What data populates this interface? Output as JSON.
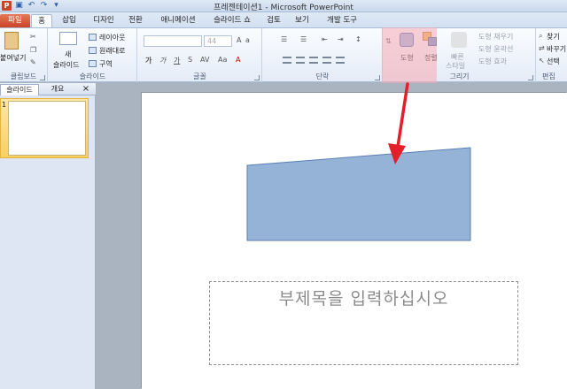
{
  "window": {
    "title": "프레젠테이션1 - Microsoft PowerPoint"
  },
  "quick_access": {
    "app_icon_letter": "P"
  },
  "tabs": [
    {
      "label": "파일"
    },
    {
      "label": "홈"
    },
    {
      "label": "삽입"
    },
    {
      "label": "디자인"
    },
    {
      "label": "전환"
    },
    {
      "label": "애니메이션"
    },
    {
      "label": "슬라이드 쇼"
    },
    {
      "label": "검토"
    },
    {
      "label": "보기"
    },
    {
      "label": "개발 도구"
    }
  ],
  "ribbon": {
    "clipboard": {
      "paste": "붙여넣기",
      "label": "클립보드"
    },
    "slides": {
      "new_slide_1": "새",
      "new_slide_2": "슬라이드",
      "layout": "레이아웃",
      "reset": "원래대로",
      "section": "구역",
      "label": "슬라이드"
    },
    "font": {
      "size": "44",
      "label": "글꼴"
    },
    "paragraph": {
      "label": "단락"
    },
    "drawing": {
      "shapes": "도형",
      "arrange": "정렬",
      "quick_styles_1": "빠른",
      "quick_styles_2": "스타일",
      "fill": "도형 채우기",
      "outline": "도형 윤곽선",
      "effects": "도형 효과",
      "label": "그리기"
    },
    "editing": {
      "find": "찾기",
      "replace": "바꾸기",
      "select": "선택",
      "label": "편집"
    }
  },
  "panel": {
    "tab_slides": "슬라이드",
    "tab_outline": "개요",
    "close": "×",
    "slide_number": "1"
  },
  "slide": {
    "subtitle_placeholder": "부제목을 입력하십시오"
  },
  "colors": {
    "shape_fill": "#95b3d7",
    "shape_stroke": "#5b7fb1",
    "arrow": "#e3202a",
    "highlight": "#f6aab4"
  }
}
